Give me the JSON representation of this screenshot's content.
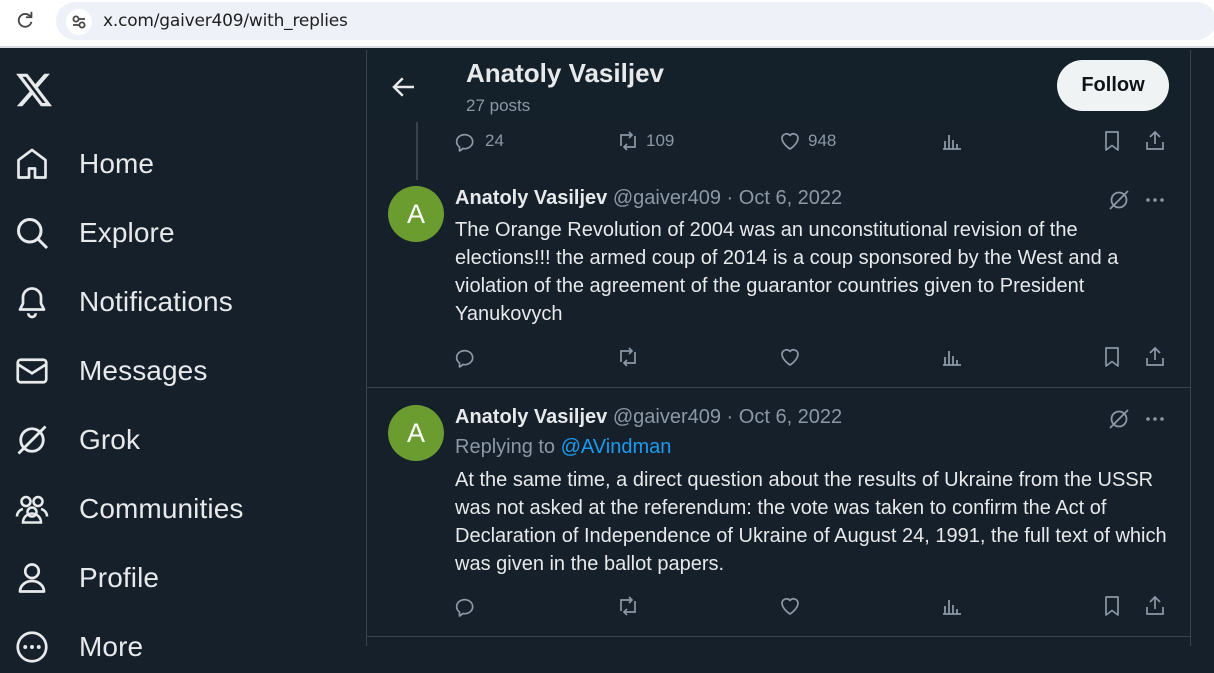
{
  "browser": {
    "url": "x.com/gaiver409/with_replies"
  },
  "sidebar": {
    "items": [
      {
        "label": "Home",
        "icon": "home-icon"
      },
      {
        "label": "Explore",
        "icon": "search-icon"
      },
      {
        "label": "Notifications",
        "icon": "bell-icon"
      },
      {
        "label": "Messages",
        "icon": "mail-icon"
      },
      {
        "label": "Grok",
        "icon": "grok-icon"
      },
      {
        "label": "Communities",
        "icon": "communities-icon"
      },
      {
        "label": "Profile",
        "icon": "person-icon"
      },
      {
        "label": "More",
        "icon": "more-circle-icon"
      }
    ]
  },
  "header": {
    "name": "Anatoly Vasiljev",
    "posts": "27 posts",
    "follow_label": "Follow"
  },
  "top_actions": {
    "replies": "24",
    "reposts": "109",
    "likes": "948"
  },
  "posts": [
    {
      "avatar_letter": "A",
      "name": "Anatoly Vasiljev",
      "meta": " @gaiver409 · Oct 6, 2022",
      "text": "The Orange Revolution of 2004 was an unconstitutional revision of the elections!!! the armed coup of 2014 is a coup sponsored by the West and a violation of the agreement of the guarantor countries given to President Yanukovych"
    },
    {
      "avatar_letter": "A",
      "name": "Anatoly Vasiljev",
      "meta": " @gaiver409 · Oct 6, 2022",
      "replying_prefix": "Replying to ",
      "replying_to": "@AVindman",
      "text": "At the same time, a direct question about the results of Ukraine from the USSR was not asked at the referendum: the vote was taken to confirm the Act of Declaration of Independence of Ukraine of August 24, 1991, the full text of which was given in the ballot papers."
    }
  ],
  "colors": {
    "background": "#15202b",
    "text": "#e7e9ea",
    "muted": "#8b98a5",
    "accent": "#1d9bf0",
    "avatar": "#6a9c2f"
  }
}
